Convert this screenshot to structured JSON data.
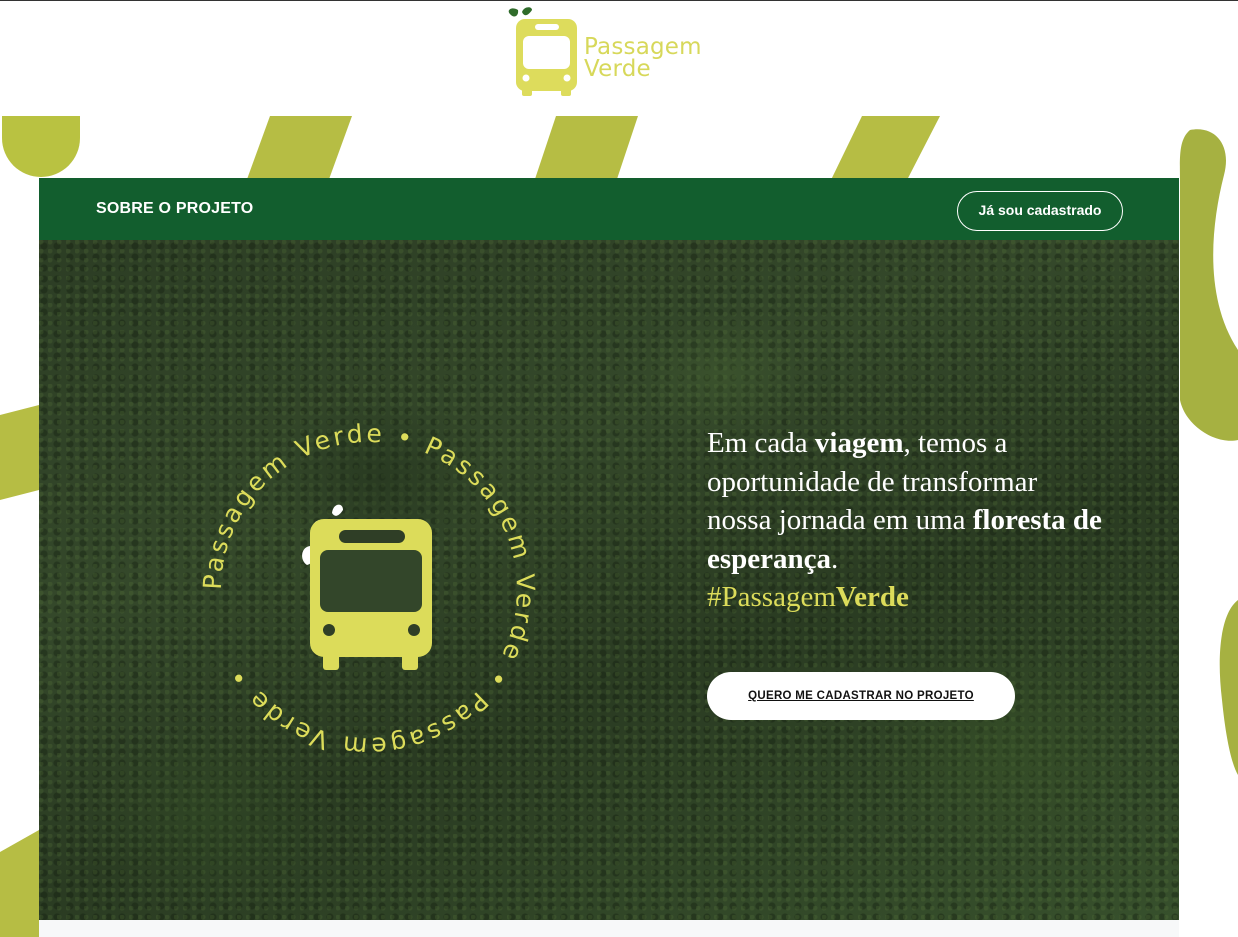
{
  "brand": {
    "line1": "Passagem",
    "line2": "Verde",
    "logo_color": "#d7d85a",
    "leaf_color": "#2f6b2a"
  },
  "navbar": {
    "about_label": "SOBRE O PROJETO",
    "login_label": "Já sou cadastrado",
    "background": "#125e2e"
  },
  "hero": {
    "badge_ring_text": "Passagem Verde • Passagem Verde • Passagem Verde • ",
    "text_part1": "Em cada ",
    "text_bold1": "viagem",
    "text_part2": ", temos a oportunidade de transformar nossa jornada em uma ",
    "text_bold2": "floresta de esperança",
    "text_part3": ".",
    "hashtag_prefix": "#Passagem",
    "hashtag_bold": "Verde",
    "cta_label": "QUERO ME CADASTRAR NO PROJETO",
    "accent": "#dcdc5a"
  },
  "decor": {
    "shape_color": "#b6bd44"
  }
}
